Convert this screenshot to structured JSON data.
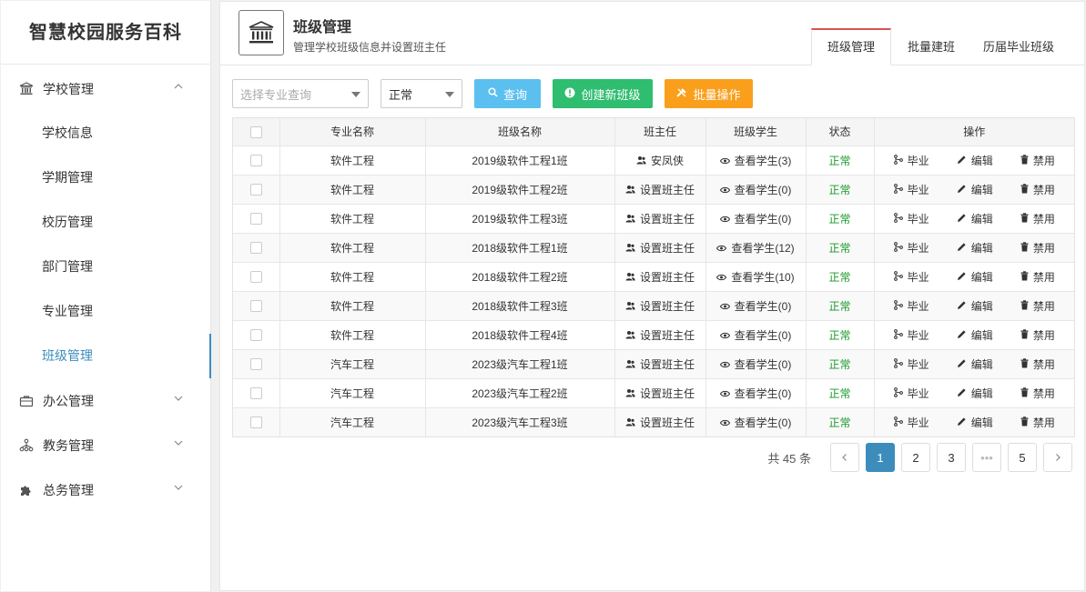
{
  "sidebar": {
    "brand": "智慧校园服务百科",
    "groups": [
      {
        "label": "学校管理",
        "icon": "bank-icon",
        "expanded": true,
        "items": [
          {
            "label": "学校信息"
          },
          {
            "label": "学期管理"
          },
          {
            "label": "校历管理"
          },
          {
            "label": "部门管理"
          },
          {
            "label": "专业管理"
          },
          {
            "label": "班级管理",
            "active": true
          }
        ]
      },
      {
        "label": "办公管理",
        "icon": "briefcase-icon",
        "expanded": false
      },
      {
        "label": "教务管理",
        "icon": "sitemap-icon",
        "expanded": false
      },
      {
        "label": "总务管理",
        "icon": "puzzle-icon",
        "expanded": false
      }
    ]
  },
  "header": {
    "title": "班级管理",
    "subtitle": "管理学校班级信息并设置班主任",
    "tabs": [
      {
        "label": "班级管理",
        "active": true
      },
      {
        "label": "批量建班"
      },
      {
        "label": "历届毕业班级"
      }
    ]
  },
  "toolbar": {
    "major_placeholder": "选择专业查询",
    "status_value": "正常",
    "query_label": "查询",
    "create_label": "创建新班级",
    "batch_label": "批量操作"
  },
  "table": {
    "headers": {
      "major": "专业名称",
      "class": "班级名称",
      "teacher": "班主任",
      "students": "班级学生",
      "status": "状态",
      "actions": "操作"
    },
    "rows": [
      {
        "major": "软件工程",
        "class": "2019级软件工程1班",
        "teacher": "安凤侠",
        "students": "查看学生(3)",
        "status": "正常"
      },
      {
        "major": "软件工程",
        "class": "2019级软件工程2班",
        "teacher": "设置班主任",
        "students": "查看学生(0)",
        "status": "正常"
      },
      {
        "major": "软件工程",
        "class": "2019级软件工程3班",
        "teacher": "设置班主任",
        "students": "查看学生(0)",
        "status": "正常"
      },
      {
        "major": "软件工程",
        "class": "2018级软件工程1班",
        "teacher": "设置班主任",
        "students": "查看学生(12)",
        "status": "正常"
      },
      {
        "major": "软件工程",
        "class": "2018级软件工程2班",
        "teacher": "设置班主任",
        "students": "查看学生(10)",
        "status": "正常"
      },
      {
        "major": "软件工程",
        "class": "2018级软件工程3班",
        "teacher": "设置班主任",
        "students": "查看学生(0)",
        "status": "正常"
      },
      {
        "major": "软件工程",
        "class": "2018级软件工程4班",
        "teacher": "设置班主任",
        "students": "查看学生(0)",
        "status": "正常"
      },
      {
        "major": "汽车工程",
        "class": "2023级汽车工程1班",
        "teacher": "设置班主任",
        "students": "查看学生(0)",
        "status": "正常"
      },
      {
        "major": "汽车工程",
        "class": "2023级汽车工程2班",
        "teacher": "设置班主任",
        "students": "查看学生(0)",
        "status": "正常"
      },
      {
        "major": "汽车工程",
        "class": "2023级汽车工程3班",
        "teacher": "设置班主任",
        "students": "查看学生(0)",
        "status": "正常"
      }
    ],
    "actions": {
      "graduate": "毕业",
      "edit": "编辑",
      "disable": "禁用"
    }
  },
  "pagination": {
    "total": "共 45 条",
    "prev_icon": "chevron-left-icon",
    "next_icon": "chevron-right-icon",
    "pages": [
      "1",
      "2",
      "3",
      "•••",
      "5"
    ],
    "current": "1"
  },
  "colors": {
    "accent": "#3c8dbc",
    "query": "#5bc0f0",
    "create": "#2fbd6f",
    "batch": "#fa9f1b",
    "status_ok": "#1a9a2a",
    "tab_active_border": "#d9534f"
  }
}
